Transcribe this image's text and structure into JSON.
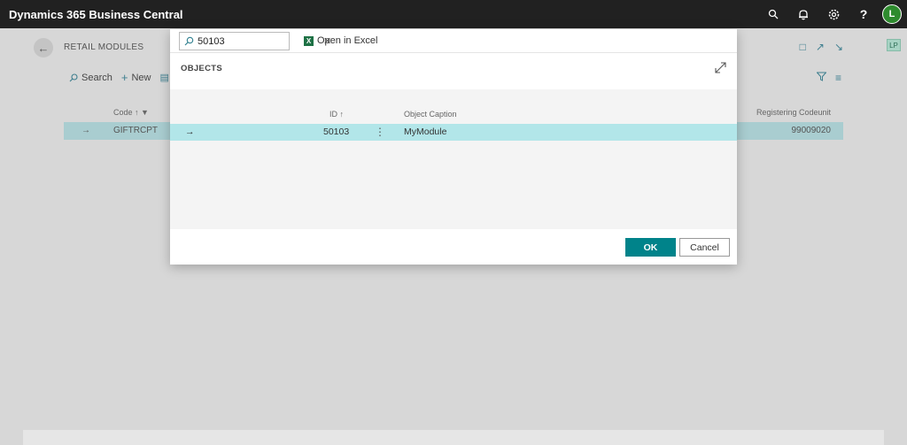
{
  "appbar": {
    "title": "Dynamics 365 Business Central",
    "icons": [
      "search-icon",
      "bell-icon",
      "gear-icon",
      "help-icon"
    ],
    "help_glyph": "?",
    "avatar_initial": "L"
  },
  "background_page": {
    "title": "RETAIL MODULES",
    "toolbar": {
      "search_label": "Search",
      "new_label": "New"
    },
    "columns": {
      "code": "Code",
      "registering_codeunit": "Registering Codeunit"
    },
    "row": {
      "code": "GIFTRCPT",
      "registering_codeunit": "99009020"
    },
    "side_badge": "LP"
  },
  "dialog": {
    "search": {
      "value": "50103"
    },
    "open_in_excel_label": "Open in Excel",
    "title": "OBJECTS",
    "columns": {
      "id": "ID",
      "object_caption": "Object Caption"
    },
    "rows": [
      {
        "id": "50103",
        "object_caption": "MyModule"
      }
    ],
    "buttons": {
      "ok": "OK",
      "cancel": "Cancel"
    }
  },
  "colors": {
    "appbar_bg": "#212121",
    "accent": "#00838a",
    "selected_row": "#b2e6e9",
    "avatar_bg": "#2e8b2e"
  }
}
